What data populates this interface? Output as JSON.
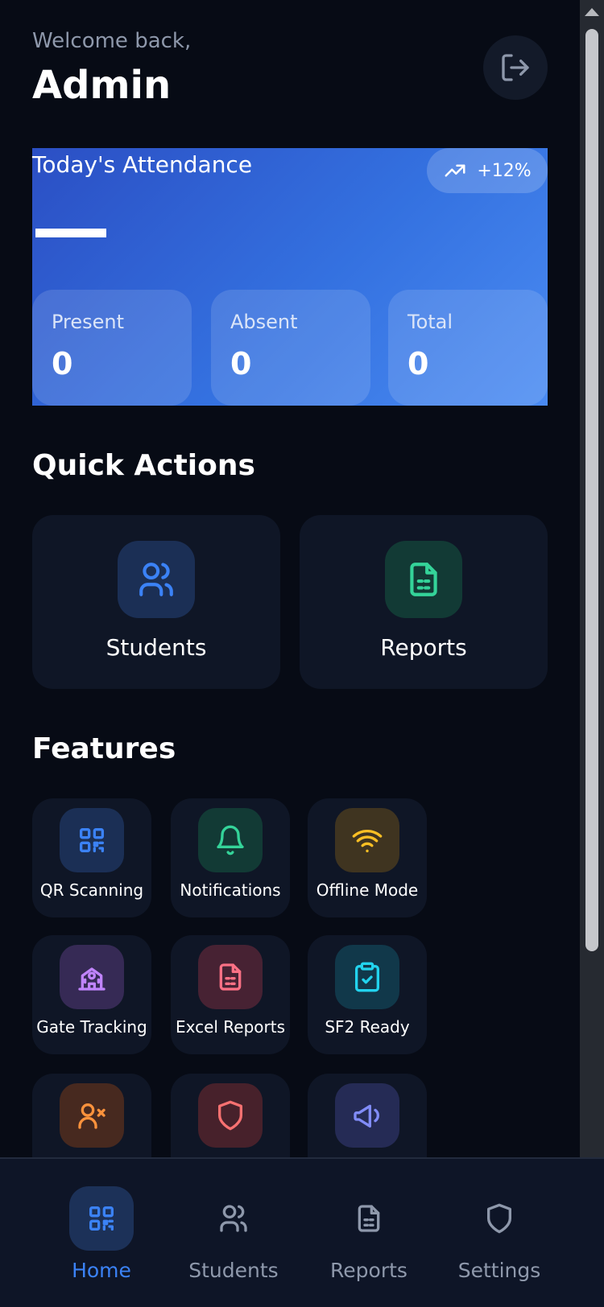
{
  "header": {
    "welcome": "Welcome back,",
    "user": "Admin"
  },
  "attendance": {
    "title": "Today's Attendance",
    "trend": "+12%",
    "stats": [
      {
        "label": "Present",
        "value": "0"
      },
      {
        "label": "Absent",
        "value": "0"
      },
      {
        "label": "Total",
        "value": "0"
      }
    ]
  },
  "quick_actions": {
    "title": "Quick Actions",
    "items": [
      {
        "label": "Students",
        "icon": "users-icon",
        "color": "#3b82f6",
        "bg": "#1b2f55"
      },
      {
        "label": "Reports",
        "icon": "file-report-icon",
        "color": "#34d399",
        "bg": "#123a35"
      }
    ]
  },
  "features": {
    "title": "Features",
    "items": [
      {
        "label": "QR Scanning",
        "icon": "qr-code-icon",
        "color": "#3b82f6",
        "bg": "#1b2f55"
      },
      {
        "label": "Notifications",
        "icon": "bell-icon",
        "color": "#34d399",
        "bg": "#123a35"
      },
      {
        "label": "Offline Mode",
        "icon": "wifi-icon",
        "color": "#fbbf24",
        "bg": "#3f3420"
      },
      {
        "label": "Gate Tracking",
        "icon": "school-building-icon",
        "color": "#c084fc",
        "bg": "#362a55"
      },
      {
        "label": "Excel Reports",
        "icon": "spreadsheet-icon",
        "color": "#fb7185",
        "bg": "#472233"
      },
      {
        "label": "SF2 Ready",
        "icon": "clipboard-check-icon",
        "color": "#22d3ee",
        "bg": "#11384a"
      },
      {
        "label": "",
        "icon": "user-x-icon",
        "color": "#fb923c",
        "bg": "#47291f"
      },
      {
        "label": "",
        "icon": "shield-icon",
        "color": "#f87171",
        "bg": "#47212b"
      },
      {
        "label": "",
        "icon": "megaphone-icon",
        "color": "#818cf8",
        "bg": "#252b55"
      }
    ]
  },
  "nav": {
    "items": [
      {
        "label": "Home",
        "icon": "qr-code-icon",
        "active": true
      },
      {
        "label": "Students",
        "icon": "users-icon",
        "active": false
      },
      {
        "label": "Reports",
        "icon": "file-report-icon",
        "active": false
      },
      {
        "label": "Settings",
        "icon": "shield-icon",
        "active": false
      }
    ]
  },
  "colors": {
    "background": "#070b15",
    "card": "#0f1626",
    "accent": "#3b82f6",
    "muted": "#8e98ab"
  }
}
